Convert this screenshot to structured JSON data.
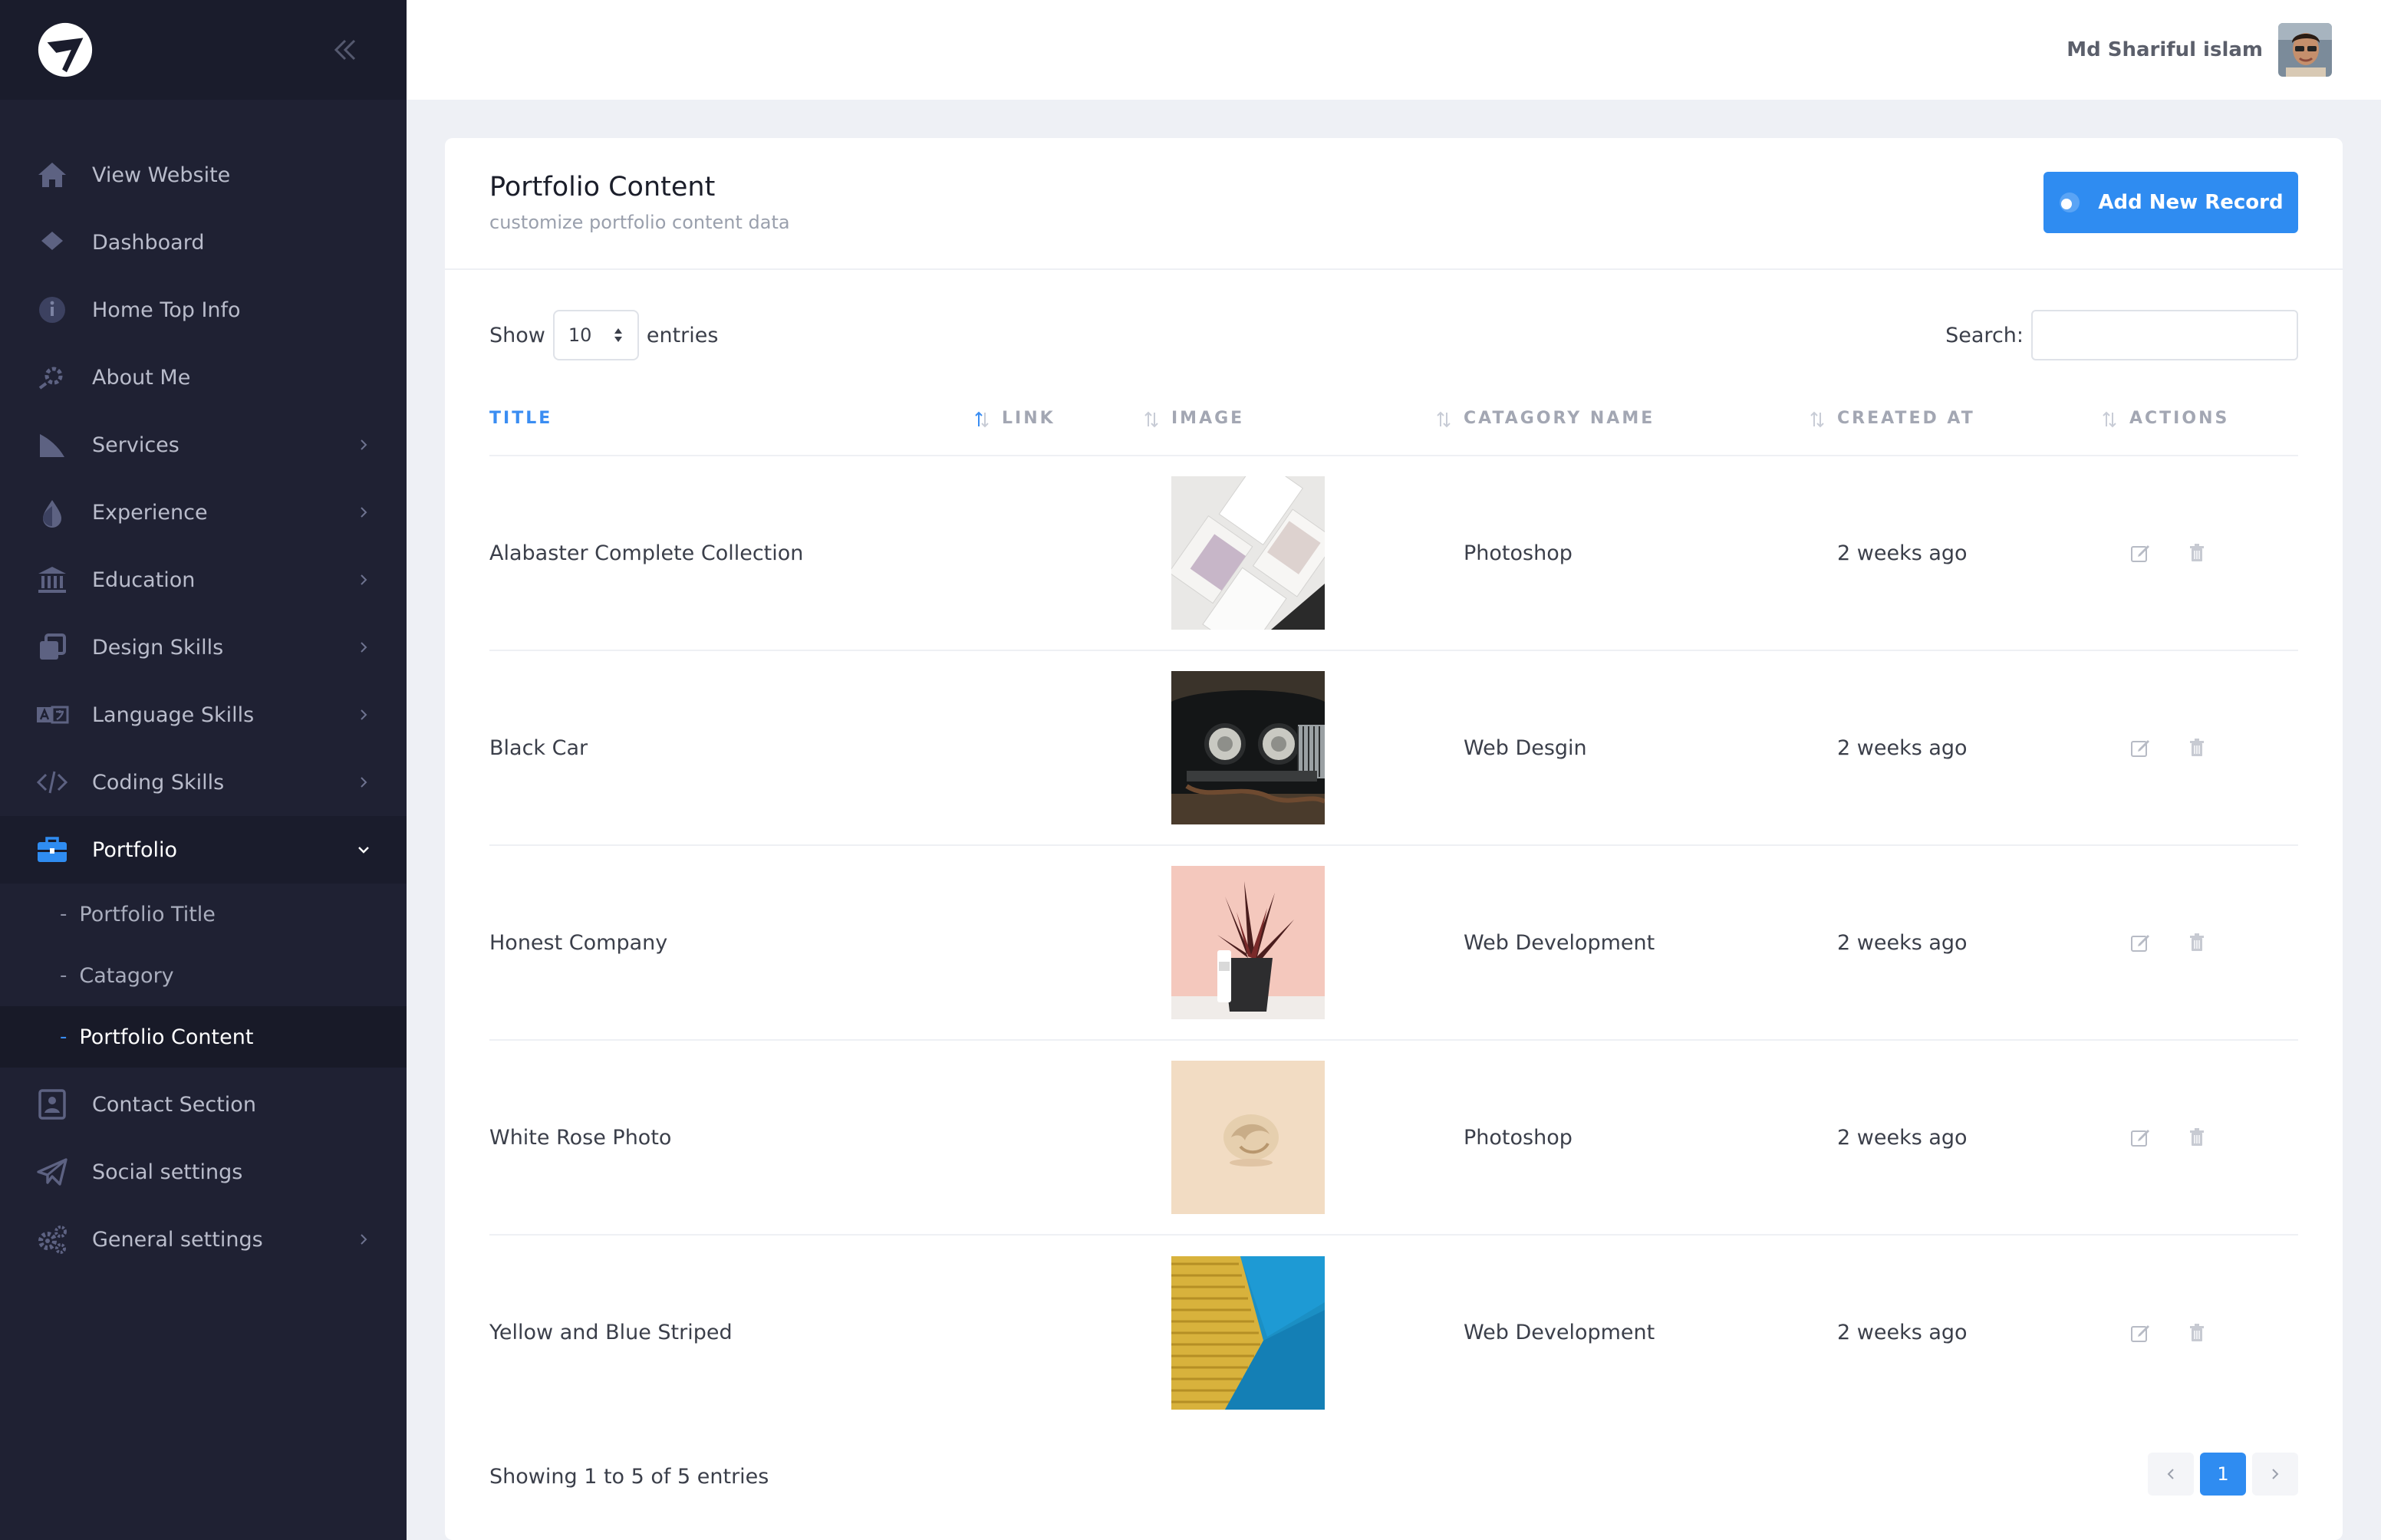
{
  "sidebar": {
    "items": [
      {
        "label": "View Website",
        "icon": "home-icon"
      },
      {
        "label": "Dashboard",
        "icon": "diamond-icon"
      },
      {
        "label": "Home Top Info",
        "icon": "info-icon"
      },
      {
        "label": "About Me",
        "icon": "gear-icon"
      },
      {
        "label": "Services",
        "icon": "chart-icon"
      },
      {
        "label": "Experience",
        "icon": "drop-icon"
      },
      {
        "label": "Education",
        "icon": "bank-icon"
      },
      {
        "label": "Design Skills",
        "icon": "copy-icon"
      },
      {
        "label": "Language Skills",
        "icon": "translate-icon"
      },
      {
        "label": "Coding Skills",
        "icon": "code-icon"
      },
      {
        "label": "Portfolio",
        "icon": "briefcase-icon"
      },
      {
        "label": "Contact Section",
        "icon": "contact-icon"
      },
      {
        "label": "Social settings",
        "icon": "send-icon"
      },
      {
        "label": "General settings",
        "icon": "cogs-icon"
      }
    ],
    "portfolio_sub": [
      {
        "label": "Portfolio Title"
      },
      {
        "label": "Catagory"
      },
      {
        "label": "Portfolio Content"
      }
    ]
  },
  "topbar": {
    "user_name": "Md Shariful islam"
  },
  "page": {
    "title": "Portfolio Content",
    "subtitle": "customize portfolio content data",
    "add_button": "Add New Record"
  },
  "controls": {
    "show_label": "Show",
    "entries_value": "10",
    "entries_label": "entries",
    "search_label": "Search:",
    "search_value": ""
  },
  "table": {
    "headers": [
      "TITLE",
      "LINK",
      "IMAGE",
      "CATAGORY NAME",
      "CREATED AT",
      "ACTIONS"
    ],
    "rows": [
      {
        "title": "Alabaster Complete Collection",
        "link": "",
        "category": "Photoshop",
        "created": "2 weeks ago"
      },
      {
        "title": "Black Car",
        "link": "",
        "category": "Web Desgin",
        "created": "2 weeks ago"
      },
      {
        "title": "Honest Company",
        "link": "",
        "category": "Web Development",
        "created": "2 weeks ago"
      },
      {
        "title": "White Rose Photo",
        "link": "",
        "category": "Photoshop",
        "created": "2 weeks ago"
      },
      {
        "title": "Yellow and Blue Striped",
        "link": "",
        "category": "Web Development",
        "created": "2 weeks ago"
      }
    ]
  },
  "footer": {
    "info": "Showing 1 to 5 of 5 entries",
    "current_page": "1"
  },
  "colors": {
    "sidebar_bg": "#1f2133",
    "accent": "#2f8cf1",
    "page_bg": "#eef0f5"
  }
}
